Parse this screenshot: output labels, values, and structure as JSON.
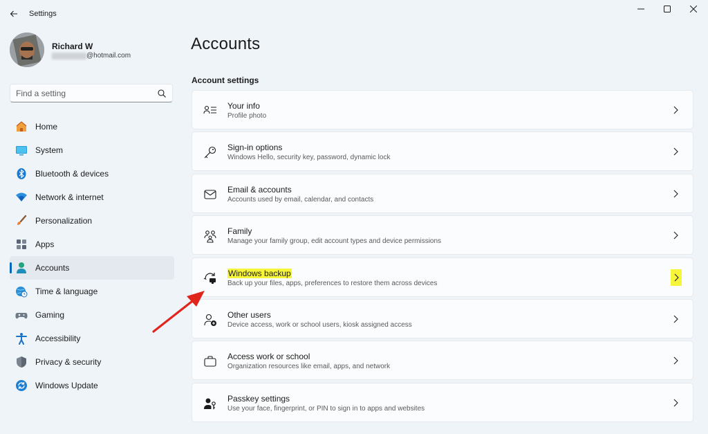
{
  "window": {
    "title": "Settings",
    "controls": [
      "minimize",
      "maximize",
      "close"
    ]
  },
  "profile": {
    "name": "Richard W",
    "email_suffix": "@hotmail.com"
  },
  "search": {
    "placeholder": "Find a setting"
  },
  "sidebar": {
    "items": [
      {
        "label": "Home",
        "icon": "home-icon"
      },
      {
        "label": "System",
        "icon": "monitor-icon"
      },
      {
        "label": "Bluetooth & devices",
        "icon": "bluetooth-icon"
      },
      {
        "label": "Network & internet",
        "icon": "wifi-icon"
      },
      {
        "label": "Personalization",
        "icon": "brush-icon"
      },
      {
        "label": "Apps",
        "icon": "apps-icon"
      },
      {
        "label": "Accounts",
        "icon": "person-icon",
        "selected": true
      },
      {
        "label": "Time & language",
        "icon": "globe-clock-icon"
      },
      {
        "label": "Gaming",
        "icon": "gamepad-icon"
      },
      {
        "label": "Accessibility",
        "icon": "accessibility-icon"
      },
      {
        "label": "Privacy & security",
        "icon": "shield-icon"
      },
      {
        "label": "Windows Update",
        "icon": "update-icon"
      }
    ]
  },
  "main": {
    "title": "Accounts",
    "section": "Account settings",
    "cards": [
      {
        "title": "Your info",
        "subtitle": "Profile photo",
        "icon": "person-lines-icon"
      },
      {
        "title": "Sign-in options",
        "subtitle": "Windows Hello, security key, password, dynamic lock",
        "icon": "key-icon"
      },
      {
        "title": "Email & accounts",
        "subtitle": "Accounts used by email, calendar, and contacts",
        "icon": "mail-icon"
      },
      {
        "title": "Family",
        "subtitle": "Manage your family group, edit account types and device permissions",
        "icon": "family-icon"
      },
      {
        "title": "Windows backup",
        "subtitle": "Back up your files, apps, preferences to restore them across devices",
        "icon": "backup-icon",
        "highlighted": true
      },
      {
        "title": "Other users",
        "subtitle": "Device access, work or school users, kiosk assigned access",
        "icon": "person-add-icon"
      },
      {
        "title": "Access work or school",
        "subtitle": "Organization resources like email, apps, and network",
        "icon": "briefcase-icon"
      },
      {
        "title": "Passkey settings",
        "subtitle": "Use your face, fingerprint, or PIN to sign in to apps and websites",
        "icon": "passkey-icon"
      }
    ]
  },
  "colors": {
    "accent": "#0067c0",
    "highlight": "#f7f53a",
    "annotation_arrow": "#e0261c",
    "background": "#eff4f9",
    "card": "#fbfcfd"
  }
}
